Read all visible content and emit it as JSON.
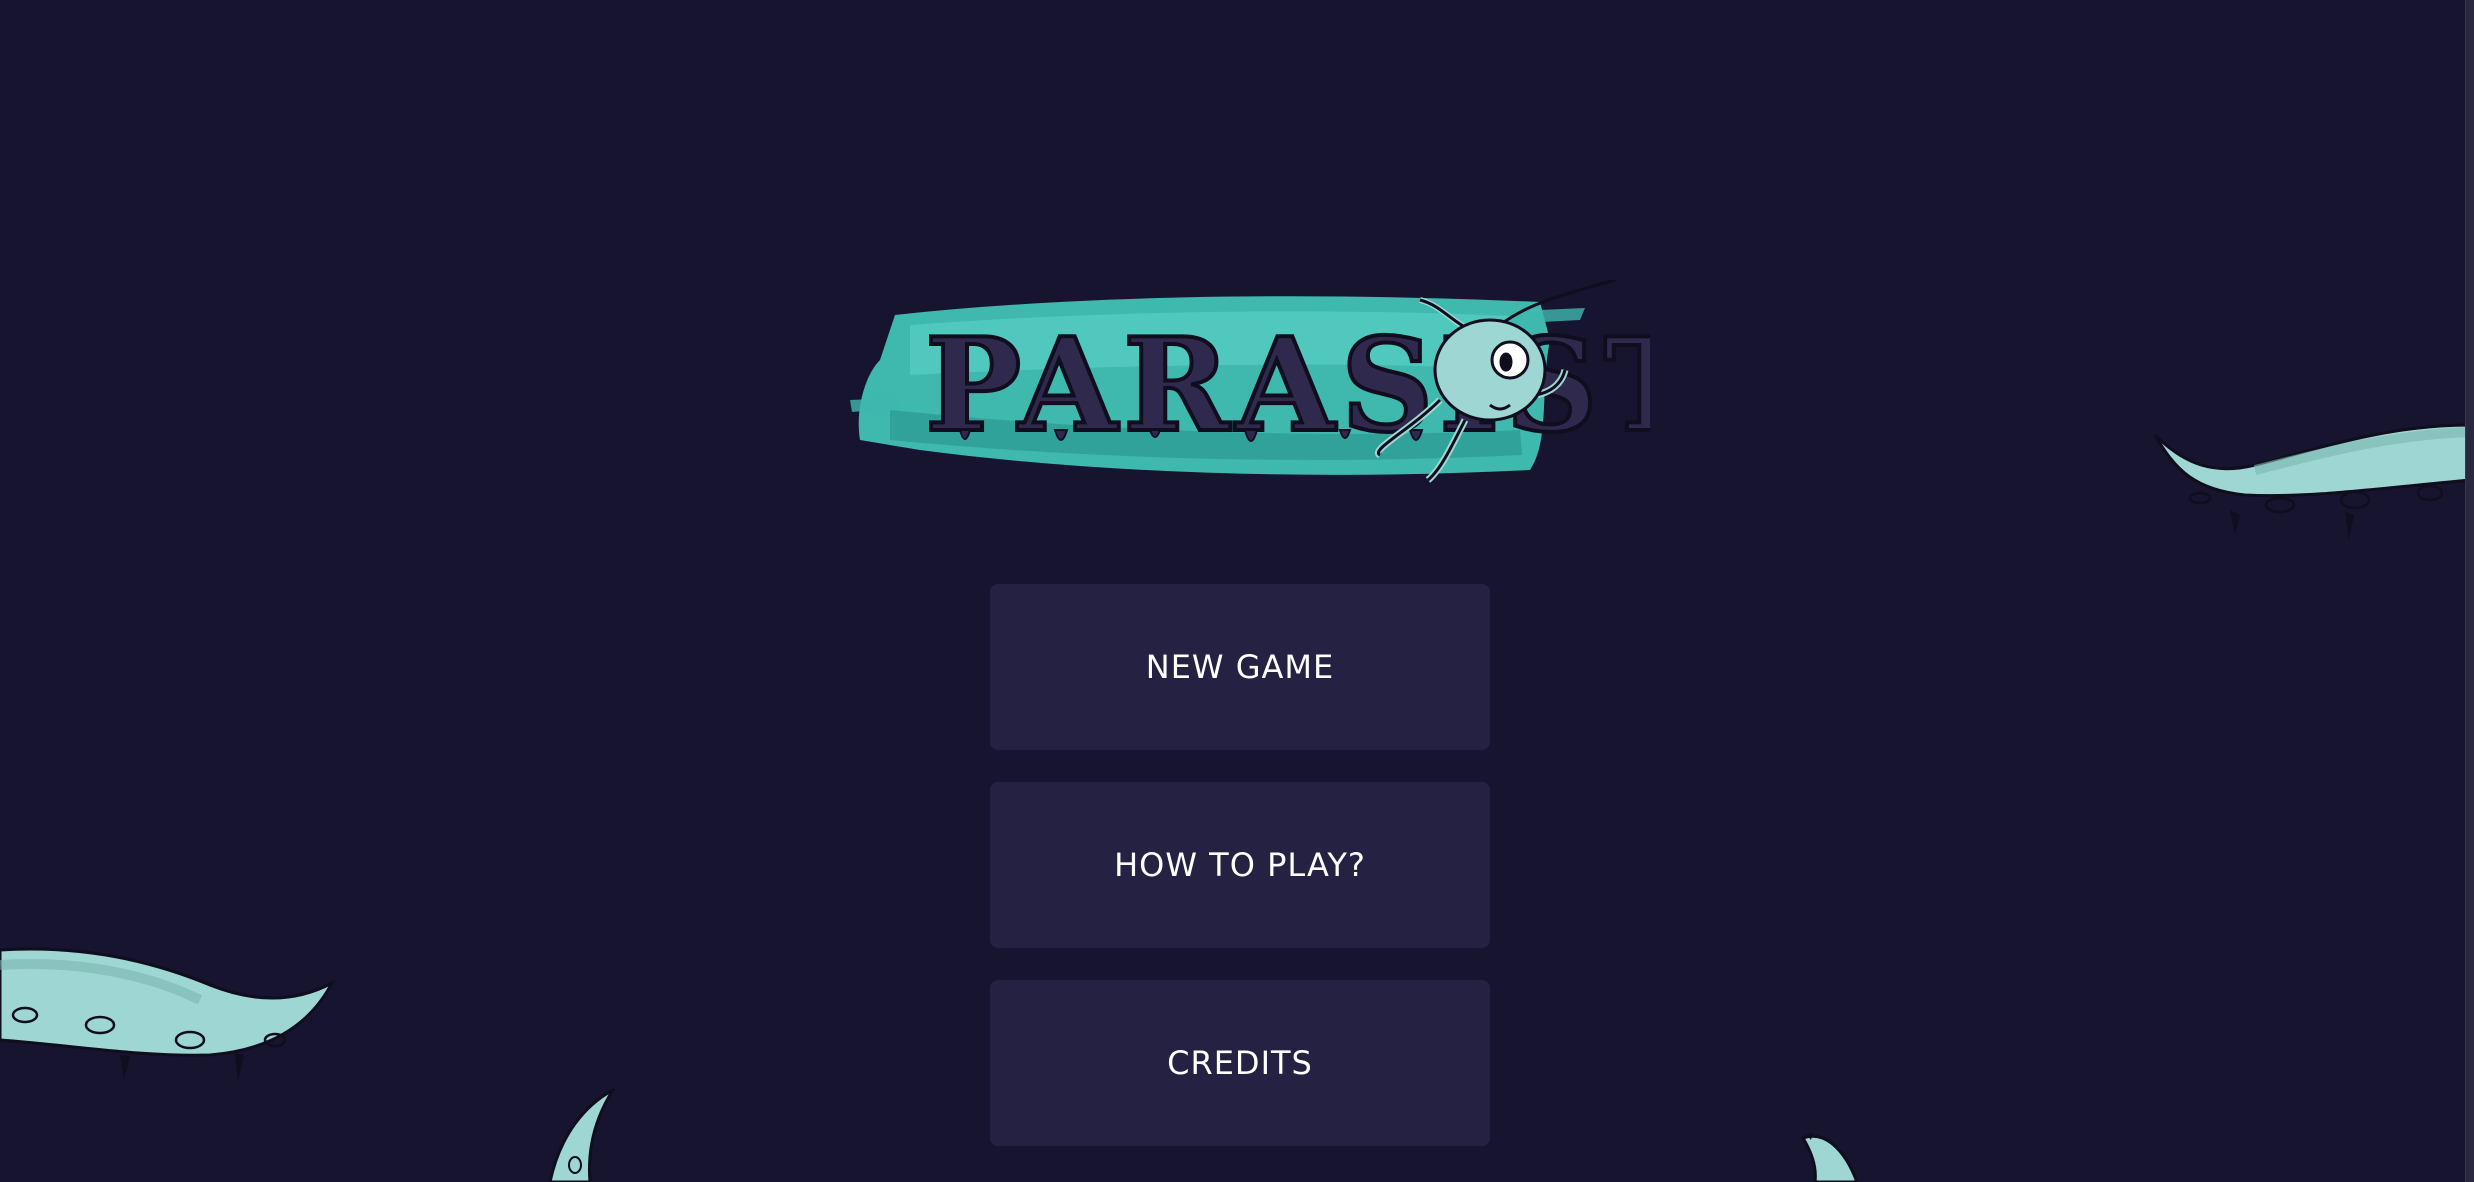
{
  "game": {
    "title": "PARASIST"
  },
  "menu": {
    "items": [
      {
        "label": "NEW GAME"
      },
      {
        "label": "HOW TO PLAY?"
      },
      {
        "label": "CREDITS"
      }
    ]
  },
  "colors": {
    "background": "#171430",
    "button": "#242143",
    "button_text": "#ffffff",
    "logo_brush": "#3fb8ae",
    "creature": "#9ed6d3",
    "logo_letters": "#2f2a4d"
  },
  "icons": {
    "mascot": "parasite-creature-icon",
    "decor": "tentacle-icon"
  }
}
